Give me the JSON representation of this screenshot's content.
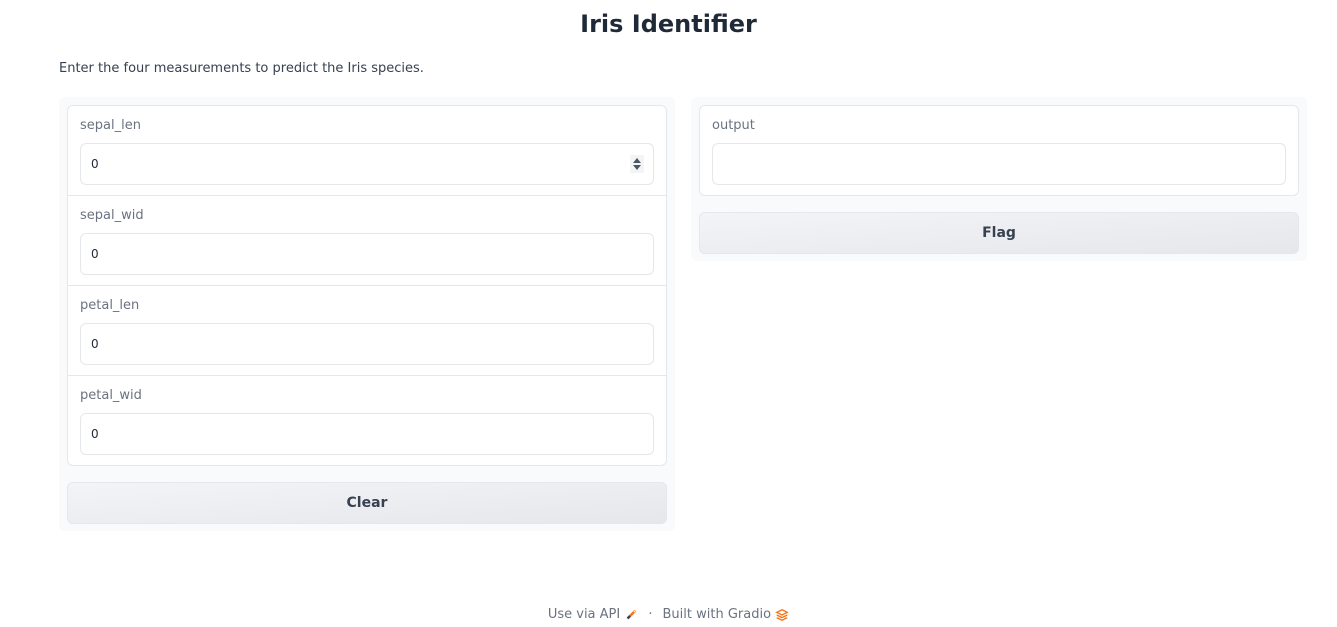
{
  "header": {
    "title": "Iris Identifier",
    "description": "Enter the four measurements to predict the Iris species."
  },
  "inputs": [
    {
      "label": "sepal_len",
      "value": "0"
    },
    {
      "label": "sepal_wid",
      "value": "0"
    },
    {
      "label": "petal_len",
      "value": "0"
    },
    {
      "label": "petal_wid",
      "value": "0"
    }
  ],
  "output": {
    "label": "output",
    "value": ""
  },
  "buttons": {
    "clear": "Clear",
    "flag": "Flag"
  },
  "footer": {
    "api_label": "Use via API",
    "separator": "·",
    "built_with": "Built with Gradio"
  },
  "colors": {
    "accent": "#f97316",
    "button_bg": "#f3f4f6"
  }
}
